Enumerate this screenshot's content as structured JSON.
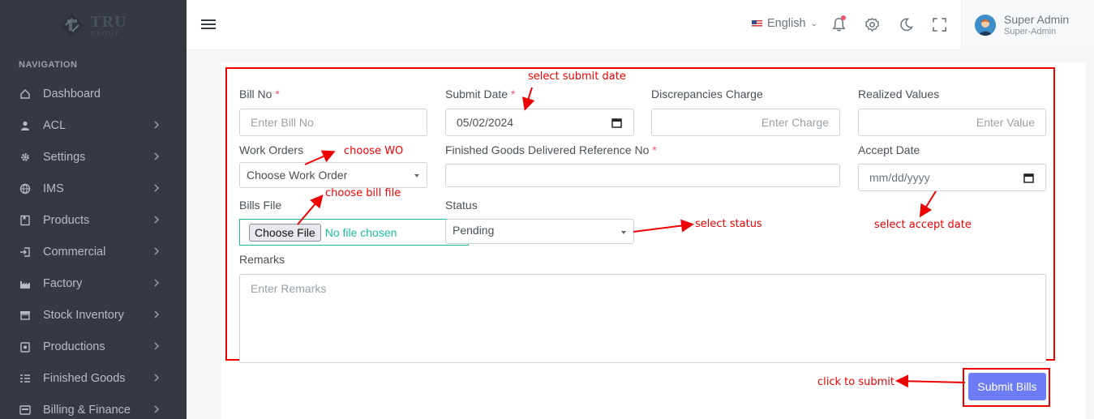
{
  "brand": {
    "name": "TRU",
    "sub": "GROUP"
  },
  "sidebar": {
    "section_title": "NAVIGATION",
    "items": [
      {
        "label": "Dashboard",
        "icon": "home-icon",
        "has_submenu": false
      },
      {
        "label": "ACL",
        "icon": "user-icon",
        "has_submenu": true
      },
      {
        "label": "Settings",
        "icon": "gear-icon",
        "has_submenu": true
      },
      {
        "label": "IMS",
        "icon": "globe-icon",
        "has_submenu": true
      },
      {
        "label": "Products",
        "icon": "bookmark-icon",
        "has_submenu": true
      },
      {
        "label": "Commercial",
        "icon": "sign-in-icon",
        "has_submenu": true
      },
      {
        "label": "Factory",
        "icon": "factory-icon",
        "has_submenu": true
      },
      {
        "label": "Stock Inventory",
        "icon": "store-icon",
        "has_submenu": true
      },
      {
        "label": "Productions",
        "icon": "clipboard-icon",
        "has_submenu": true
      },
      {
        "label": "Finished Goods",
        "icon": "list-icon",
        "has_submenu": true
      },
      {
        "label": "Billing & Finance",
        "icon": "billing-icon",
        "has_submenu": true
      }
    ]
  },
  "topbar": {
    "language": "English",
    "user": {
      "name": "Super Admin",
      "role": "Super-Admin"
    }
  },
  "form": {
    "bill_no": {
      "label": "Bill No",
      "required": "*",
      "placeholder": "Enter Bill No"
    },
    "submit_date": {
      "label": "Submit Date",
      "required": "*",
      "value": "05/02/2024"
    },
    "discrepancies_charge": {
      "label": "Discrepancies Charge",
      "placeholder": "Enter Charge"
    },
    "realized_values": {
      "label": "Realized Values",
      "placeholder": "Enter Value"
    },
    "work_orders": {
      "label": "Work Orders",
      "value": "Choose Work Order"
    },
    "fg_reference": {
      "label": "Finished Goods Delivered Reference No",
      "required": "*",
      "value": ""
    },
    "accept_date": {
      "label": "Accept Date",
      "placeholder": "mm/dd/yyyy"
    },
    "bills_file": {
      "label": "Bills File",
      "button": "Choose File",
      "status": "No file chosen"
    },
    "status": {
      "label": "Status",
      "value": "Pending"
    },
    "remarks": {
      "label": "Remarks",
      "placeholder": "Enter Remarks"
    },
    "submit_label": "Submit Bills"
  },
  "annotations": {
    "submit_date": "select submit date",
    "work_order": "choose WO",
    "bill_file": "choose bill file",
    "status": "select status",
    "accept_date": "select accept date",
    "submit": "click to submit"
  },
  "colors": {
    "sidebar": "#343a40",
    "accent": "#6c7cf4",
    "annotation": "#e00000",
    "success": "#1abc9c"
  }
}
